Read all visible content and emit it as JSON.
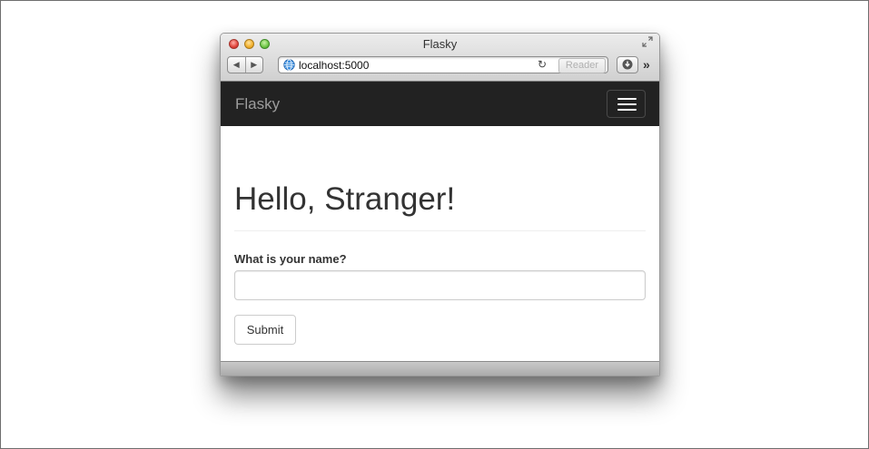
{
  "window": {
    "title": "Flasky"
  },
  "toolbar": {
    "back_icon": "back-arrow-icon",
    "forward_icon": "forward-arrow-icon",
    "url": "localhost:5000",
    "reload_icon": "reload-icon",
    "reader_label": "Reader",
    "download_icon": "download-icon",
    "overflow_label": "»"
  },
  "navbar": {
    "brand": "Flasky",
    "toggle_icon": "hamburger-menu-icon",
    "background": "#222222"
  },
  "main": {
    "heading": "Hello, Stranger!",
    "form": {
      "label": "What is your name?",
      "input_value": "",
      "submit_label": "Submit"
    }
  }
}
